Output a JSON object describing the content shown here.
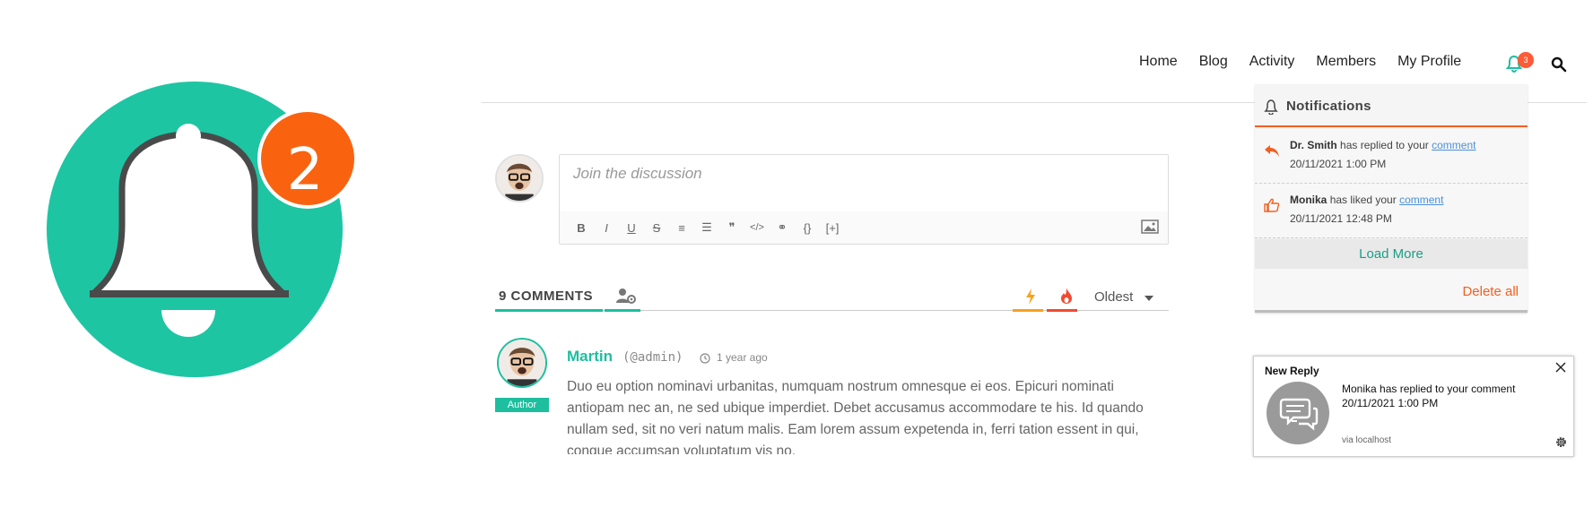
{
  "logo": {
    "icon": "bell-icon",
    "badge_count": "2",
    "colors": {
      "circle": "#1dc5a3",
      "badge": "#f96310",
      "bell_outline": "#4a4a4a"
    }
  },
  "navbar": {
    "items": [
      {
        "label": "Home"
      },
      {
        "label": "Blog"
      },
      {
        "label": "Activity"
      },
      {
        "label": "Members"
      },
      {
        "label": "My Profile"
      }
    ],
    "bell_badge": "3",
    "icons": [
      "bell-icon",
      "search-icon"
    ]
  },
  "comment_form": {
    "placeholder": "Join the discussion",
    "toolbar": [
      {
        "name": "bold",
        "glyph": "B"
      },
      {
        "name": "italic",
        "glyph": "I"
      },
      {
        "name": "underline",
        "glyph": "U"
      },
      {
        "name": "strikethrough",
        "glyph": "S"
      },
      {
        "name": "ordered-list",
        "glyph": "≡"
      },
      {
        "name": "unordered-list",
        "glyph": "☰"
      },
      {
        "name": "blockquote",
        "glyph": "❞"
      },
      {
        "name": "code",
        "glyph": "</>"
      },
      {
        "name": "link",
        "glyph": "⚭"
      },
      {
        "name": "source-code",
        "glyph": "{}"
      },
      {
        "name": "spoiler",
        "glyph": "[+]"
      }
    ]
  },
  "comments_header": {
    "count_label": "9 COMMENTS",
    "sort": "Oldest",
    "colors": {
      "accent": "#1dbf9f",
      "bolt": "#f8a11b",
      "flame": "#f04a32"
    }
  },
  "comment": {
    "author": "Martin",
    "handle": "(@admin)",
    "time": "1 year ago",
    "role": "Author",
    "text": "Duo eu option nominavi urbanitas, numquam nostrum omnesque ei eos. Epicuri nominati antiopam nec an, ne sed ubique imperdiet. Debet accusamus accommodare te his. Id quando nullam sed, sit no veri natum malis. Eam lorem assum expetenda in, ferri tation essent in qui, congue accumsan voluptatum vis no."
  },
  "notifications": {
    "title": "Notifications",
    "items": [
      {
        "user": "Dr. Smith",
        "action": "has replied to your",
        "link": "comment",
        "date": "20/11/2021 1:00 PM",
        "icon": "reply-icon"
      },
      {
        "user": "Monika",
        "action": "has liked your",
        "link": "comment",
        "date": "20/11/2021 12:48 PM",
        "icon": "thumbs-up-icon"
      }
    ],
    "load_more": "Load More",
    "delete_all": "Delete all"
  },
  "toast": {
    "title": "New Reply",
    "message": "Monika has replied to your comment",
    "date": "20/11/2021 1:00 PM",
    "via": "via localhost"
  }
}
